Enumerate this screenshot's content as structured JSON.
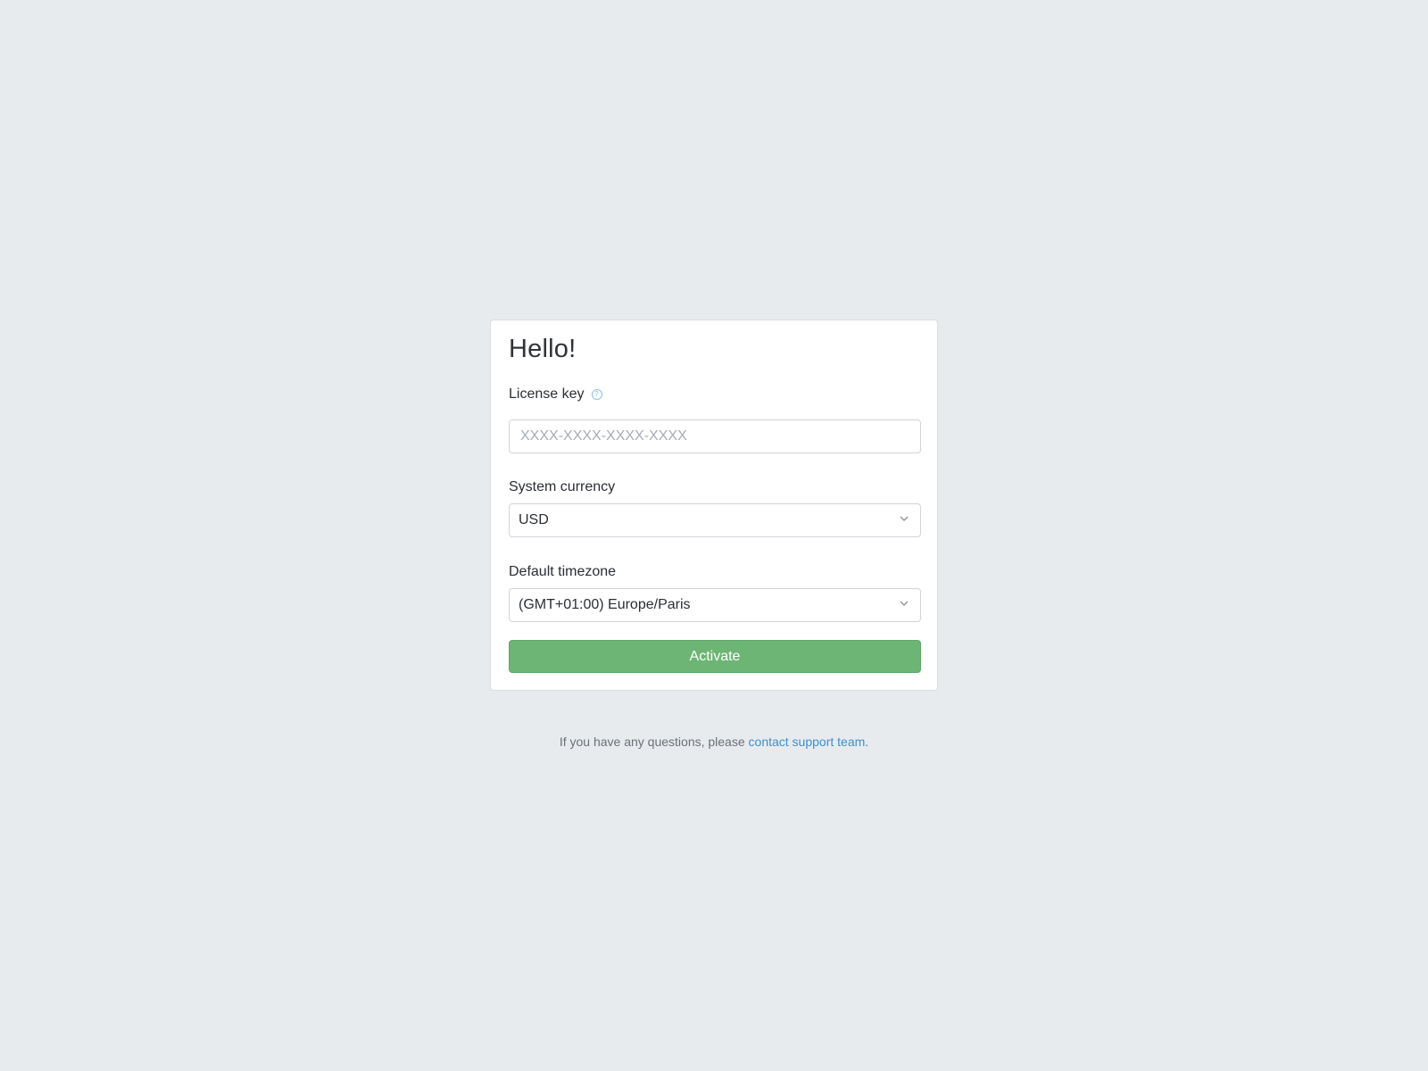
{
  "card": {
    "title": "Hello!",
    "license": {
      "label": "License key",
      "placeholder": "XXXX-XXXX-XXXX-XXXX",
      "value": ""
    },
    "currency": {
      "label": "System currency",
      "selected": "USD"
    },
    "timezone": {
      "label": "Default timezone",
      "selected": "(GMT+01:00) Europe/Paris"
    },
    "activate_label": "Activate"
  },
  "footer": {
    "text_before": "If you have any questions, please ",
    "link_text": "contact support team",
    "text_after": "."
  },
  "icons": {
    "help": "help-circle-icon",
    "select_arrow": "chevron-down-icon"
  },
  "colors": {
    "background": "#e8ebee",
    "primary_button": "#6db574",
    "link": "#3a8fd0"
  }
}
